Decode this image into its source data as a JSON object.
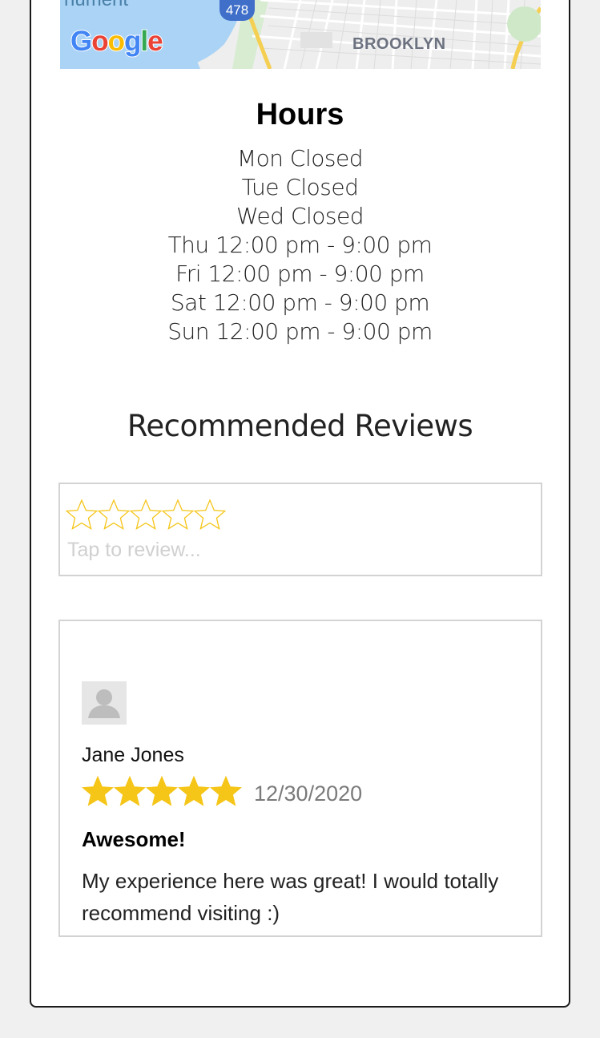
{
  "map": {
    "top_fragment": "nument",
    "route_shield": "478",
    "area_label": "BROOKLYN",
    "logo_letters": [
      {
        "ch": "G",
        "color": "#4285F4"
      },
      {
        "ch": "o",
        "color": "#EA4335"
      },
      {
        "ch": "o",
        "color": "#FBBC05"
      },
      {
        "ch": "g",
        "color": "#4285F4"
      },
      {
        "ch": "l",
        "color": "#34A853"
      },
      {
        "ch": "e",
        "color": "#EA4335"
      }
    ]
  },
  "hours": {
    "title": "Hours",
    "lines": [
      "Mon Closed",
      "Tue Closed",
      "Wed Closed",
      "Thu 12:00 pm - 9:00 pm",
      "Fri 12:00 pm - 9:00 pm",
      "Sat 12:00 pm - 9:00 pm",
      "Sun 12:00 pm - 9:00 pm"
    ]
  },
  "reviews": {
    "section_title": "Recommended Reviews",
    "compose": {
      "placeholder": "Tap to review...",
      "rating": 0,
      "max_rating": 5,
      "star_color": "#f5c518"
    },
    "items": [
      {
        "name": "Jane Jones",
        "rating": 5,
        "date": "12/30/2020",
        "title": "Awesome!",
        "body": "My experience here was great! I would totally recommend visiting :)",
        "avatar_icon": "user-silhouette-icon"
      }
    ]
  },
  "colors": {
    "star": "#f5c518",
    "card_border": "#1a1a1a",
    "box_border": "#d3d3d3",
    "page_bg": "#f0f0f0"
  }
}
